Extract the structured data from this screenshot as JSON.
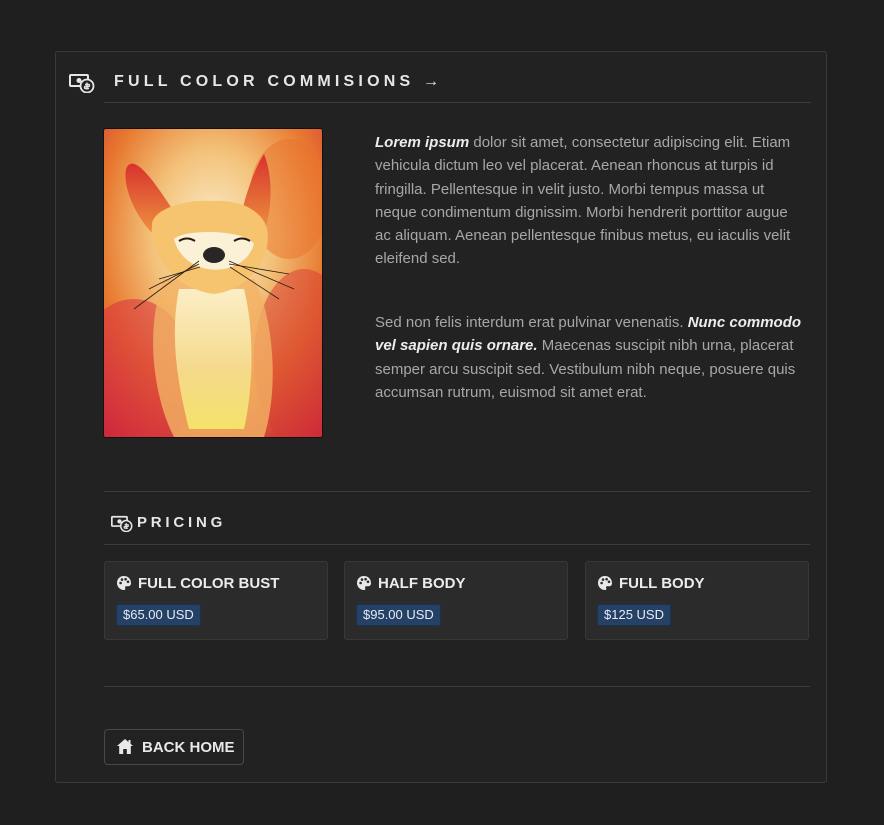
{
  "header": {
    "title": "FULL COLOR COMMISIONS →",
    "icon": "money-icon"
  },
  "artwork": {
    "subject": "watercolor fox painting",
    "icon": "artwork-image"
  },
  "description": {
    "p1_bold": "Lorem ipsum",
    "p1_rest": " dolor sit amet, consectetur adipiscing elit. Etiam vehicula dictum leo vel placerat. Aenean rhoncus at turpis id fringilla. Pellentesque in velit justo. Morbi tempus massa ut neque condimentum dignissim. Morbi hendrerit porttitor augue ac aliquam. Aenean pellentesque finibus metus, eu iaculis velit eleifend sed.",
    "p2_start": "Sed non felis interdum erat pulvinar venenatis. ",
    "p2_bold": "Nunc commodo vel sapien quis ornare.",
    "p2_rest": " Maecenas suscipit nibh urna, placerat semper arcu suscipit sed. Vestibulum nibh neque, posuere quis accumsan rutrum, euismod sit amet erat."
  },
  "pricing": {
    "heading": "PRICING",
    "items": [
      {
        "name": "FULL COLOR BUST",
        "price": "$65.00 USD"
      },
      {
        "name": "HALF BODY",
        "price": "$95.00 USD"
      },
      {
        "name": "FULL BODY",
        "price": "$125 USD"
      }
    ]
  },
  "footer": {
    "back_label": "BACK HOME"
  },
  "colors": {
    "background": "#1f1f1f",
    "card": "#222222",
    "badge": "#254165",
    "text": "#a7a7a7",
    "heading": "#e6e6e6"
  }
}
